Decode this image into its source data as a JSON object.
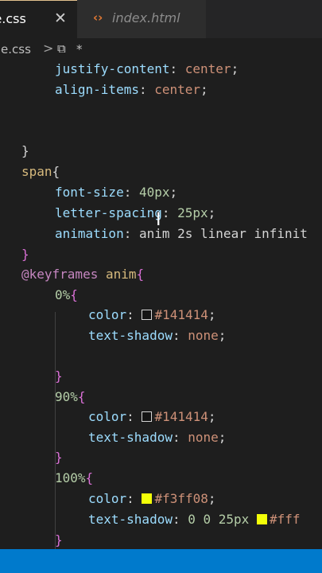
{
  "tabs": [
    {
      "label": "le.css",
      "active": true
    },
    {
      "label": "index.html",
      "active": false
    }
  ],
  "icons": {
    "close": "close-icon",
    "html_file": "html-file-icon",
    "css_symbol": "css-symbol-icon"
  },
  "breadcrumb": {
    "file": "yle.css",
    "separator": ">",
    "symbol": "⧉",
    "item": "*"
  },
  "code": {
    "l1": {
      "prop": "justify-content",
      "value": "center"
    },
    "l2": {
      "prop": "align-items",
      "value": "center"
    },
    "close_brace": "}",
    "span_selector": "span",
    "open_brace": "{",
    "font_size": {
      "prop": "font-size",
      "value": "40px"
    },
    "letter_spacing": {
      "prop": "letter-spacing",
      "value": "25px"
    },
    "animation": {
      "prop": "animation",
      "value": "anim 2s linear infinit"
    },
    "keyframes": {
      "at": "@keyframes",
      "name": "anim"
    },
    "kf0": {
      "selector": "0%",
      "color_prop": "color",
      "color_value": "#141414",
      "shadow_prop": "text-shadow",
      "shadow_value": "none"
    },
    "kf90": {
      "selector": "90%",
      "color_prop": "color",
      "color_value": "#141414",
      "shadow_prop": "text-shadow",
      "shadow_value": "none"
    },
    "kf100": {
      "selector": "100%",
      "color_prop": "color",
      "color_value": "#f3ff08",
      "shadow_prop": "text-shadow",
      "shadow_value": "0 0 25px",
      "shadow_color": "#fff"
    }
  },
  "colors": {
    "swatch_dark": "#141414",
    "swatch_yellow": "#f3ff08",
    "status_bar": "#007acc",
    "tab_border": "#e2c08d"
  }
}
